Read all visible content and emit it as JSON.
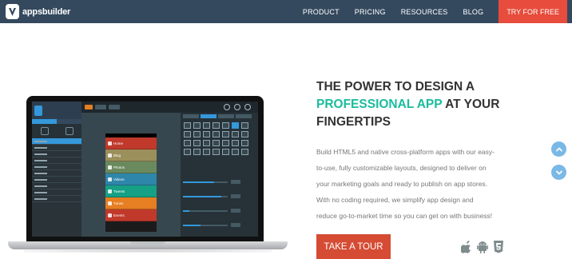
{
  "nav": {
    "logo_text": "appsbuilder",
    "links": [
      "PRODUCT",
      "PRICING",
      "RESOURCES",
      "BLOG"
    ],
    "cta": "TRY FOR FREE"
  },
  "hero": {
    "headline_line1": "THE POWER TO DESIGN A",
    "headline_accent": "PROFESSIONAL APP",
    "headline_after_accent": " AT YOUR",
    "headline_line3": "FINGERTIPS",
    "body_lines": [
      "Build HTML5 and native cross-platform apps with our easy-",
      "to-use, fully customizable layouts, designed to deliver on",
      "your marketing goals and ready to publish on app stores.",
      "With no coding required, we simplify app design and",
      "reduce go-to-market time so you can get on with business!"
    ],
    "cta": "TAKE A TOUR",
    "platform_icons": [
      "apple-icon",
      "android-icon",
      "html5-icon"
    ]
  },
  "phone_menu": [
    {
      "label": "Home",
      "color": "#c0392b"
    },
    {
      "label": "Blog",
      "color": "#9b8f5b"
    },
    {
      "label": "Photos",
      "color": "#6a8a5e"
    },
    {
      "label": "Videos",
      "color": "#2e86ab"
    },
    {
      "label": "Tweets",
      "color": "#16a085"
    },
    {
      "label": "Tunes",
      "color": "#e67e22"
    },
    {
      "label": "Events",
      "color": "#c0392b"
    }
  ],
  "colors": {
    "nav_bg": "#34495e",
    "cta_red": "#e74c3c",
    "accent_teal": "#1abc9c",
    "tour_red": "#d54b34",
    "scroll_blue": "#7ab8e6"
  },
  "scroll": {
    "up_icon": "chevron-up-icon",
    "down_icon": "chevron-down-icon"
  }
}
